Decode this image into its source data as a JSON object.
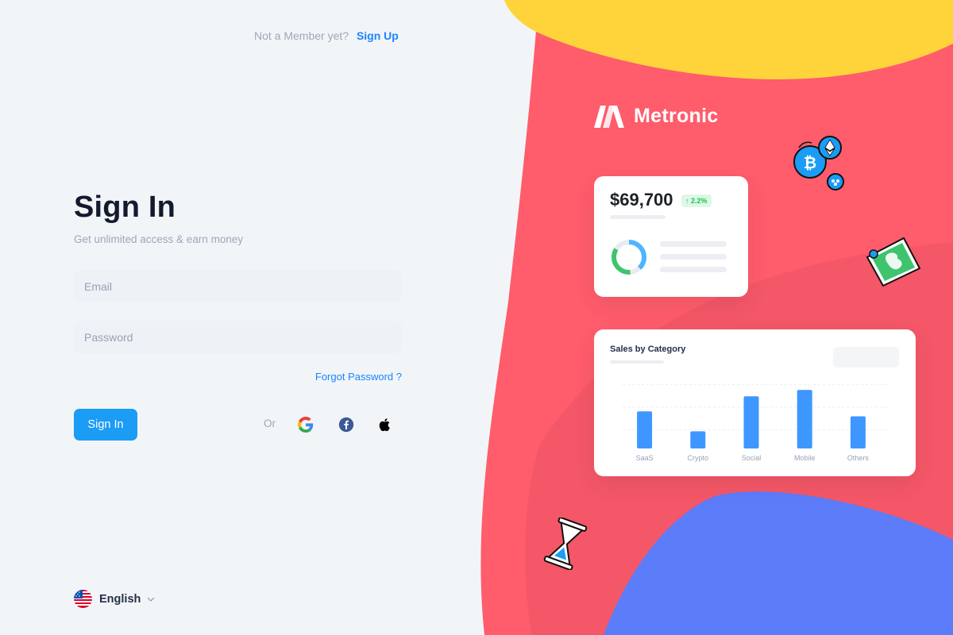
{
  "header": {
    "prompt": "Not a Member yet?",
    "signup_link": "Sign Up"
  },
  "signin": {
    "title": "Sign In",
    "subtitle": "Get unlimited access & earn money",
    "email_placeholder": "Email",
    "password_placeholder": "Password",
    "forgot_link": "Forgot Password ?",
    "submit_label": "Sign In",
    "or_label": "Or",
    "social": [
      "google-icon",
      "facebook-icon",
      "apple-icon"
    ]
  },
  "language": {
    "selected": "English",
    "flag": "us-flag-icon"
  },
  "brand": {
    "name": "Metronic"
  },
  "stats_card": {
    "amount": "$69,700",
    "change": "2.2%"
  },
  "colors": {
    "accent": "#1b84ff",
    "button": "#1b9cf5",
    "art_red": "#ff5c6c",
    "art_yellow": "#ffd43b",
    "art_blue": "#5c7cfa"
  },
  "chart_data": {
    "type": "bar",
    "title": "Sales by Category",
    "categories": [
      "SaaS",
      "Crypto",
      "Social",
      "Mobile",
      "Others"
    ],
    "values": [
      52,
      24,
      73,
      82,
      45
    ],
    "xlabel": "",
    "ylabel": "",
    "ylim": [
      0,
      100
    ],
    "grid": true
  }
}
